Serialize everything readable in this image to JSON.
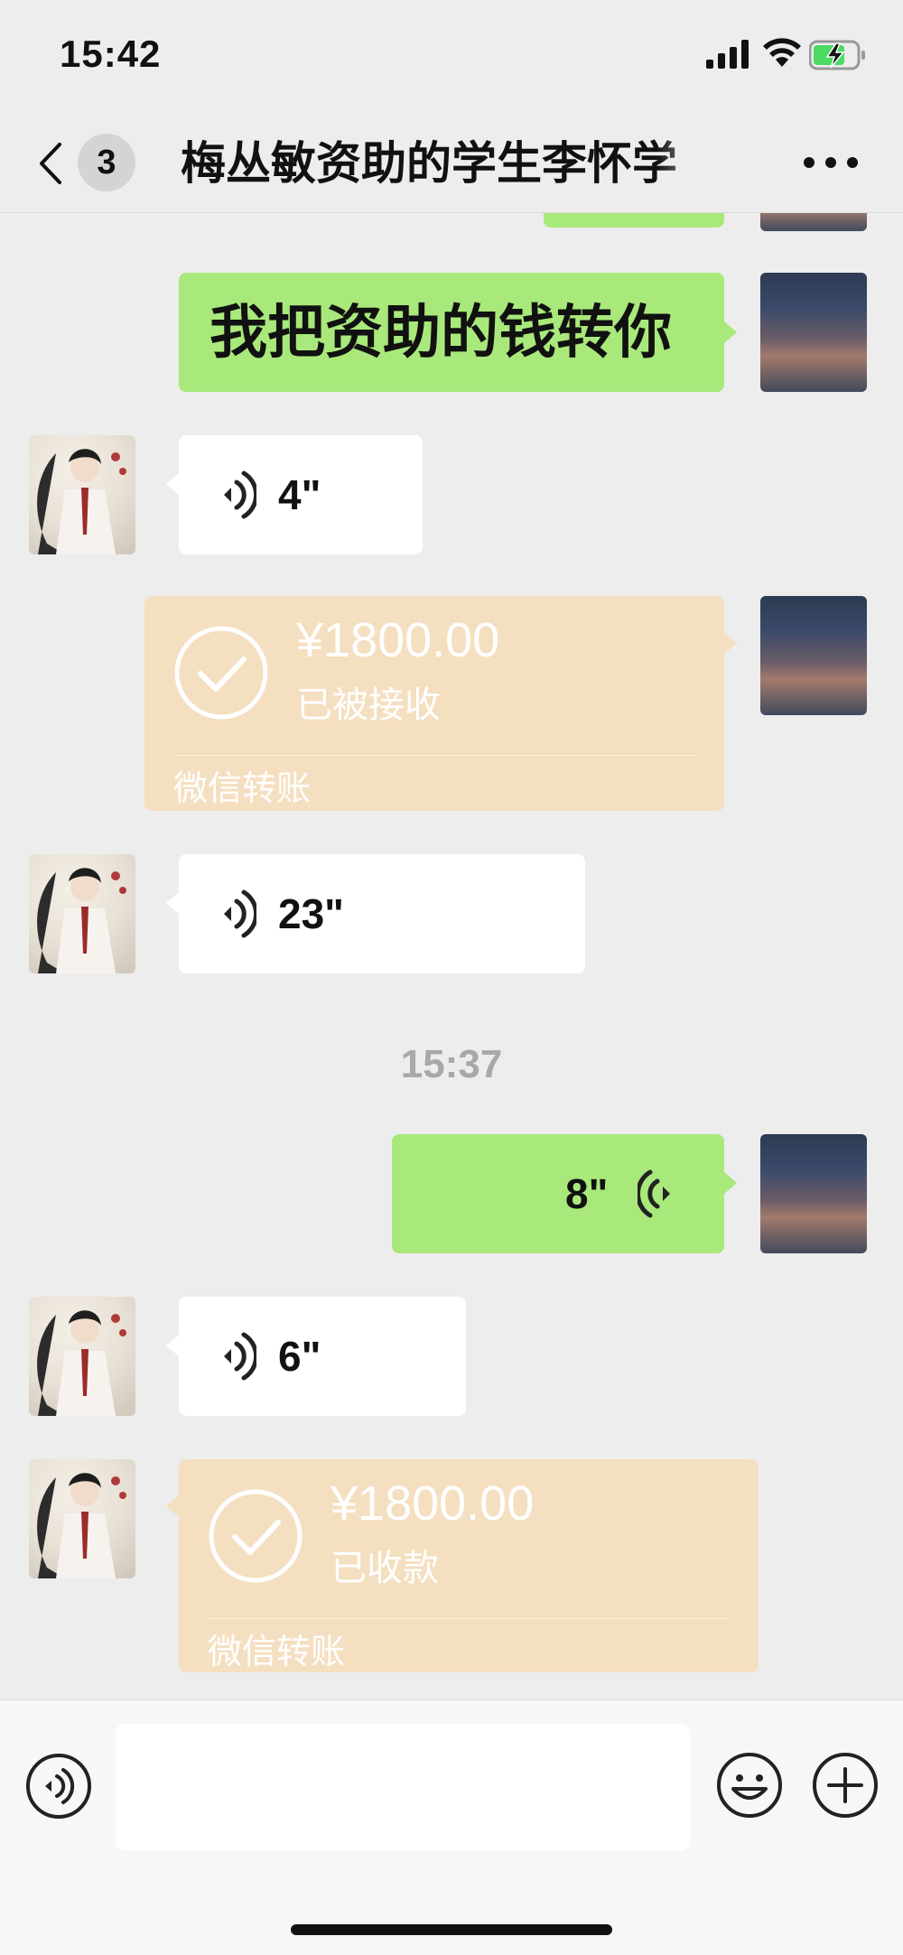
{
  "status_bar": {
    "time": "15:42"
  },
  "nav": {
    "unread_count": "3",
    "title": "梅丛敏资助的学生李怀学"
  },
  "messages": [
    {
      "type": "text",
      "from": "self",
      "text": "我把资助的钱转你"
    },
    {
      "type": "voice",
      "from": "other",
      "duration": "4\""
    },
    {
      "type": "transfer",
      "from": "self",
      "amount": "¥1800.00",
      "status": "已被接收",
      "footer": "微信转账"
    },
    {
      "type": "voice",
      "from": "other",
      "duration": "23\""
    },
    {
      "type": "timestamp",
      "text": "15:37"
    },
    {
      "type": "voice",
      "from": "self",
      "duration": "8\""
    },
    {
      "type": "voice",
      "from": "other",
      "duration": "6\""
    },
    {
      "type": "transfer",
      "from": "other",
      "amount": "¥1800.00",
      "status": "已收款",
      "footer": "微信转账"
    }
  ],
  "colors": {
    "self_bubble": "#a9e87a",
    "other_bubble": "#ffffff",
    "transfer_bubble": "#f5dfc1",
    "background": "#ededed"
  },
  "input_bar": {
    "message_value": ""
  }
}
